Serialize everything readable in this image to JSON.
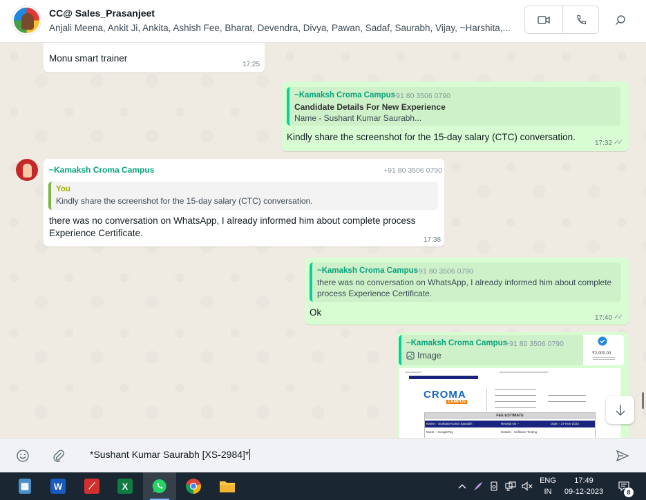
{
  "header": {
    "title": "CC@ Sales_Prasanjeet",
    "members": "Anjali Meena, Ankit Ji, Ankita, Ashish Fee, Bharat, Devendra, Divya, Pawan, Sadaf, Saurabh, Vijay, ~Harshita,..."
  },
  "messages": {
    "m1": {
      "text": "Monu smart trainer",
      "time": "17:25"
    },
    "m2": {
      "quote_author": "~Kamaksh Croma Campus",
      "quote_phone": "+91 80 3506 0790",
      "quote_line1": "Candidate Details For New Experience",
      "quote_line2": "Name - Sushant Kumar Saurabh...",
      "text": "Kindly share the screenshot for the 15-day salary (CTC) conversation.",
      "time": "17:32"
    },
    "m3": {
      "author": "~Kamaksh Croma Campus",
      "phone": "+91 80 3506 0790",
      "quote_author": "You",
      "quote_text": "Kindly share the screenshot for the 15-day salary (CTC) conversation.",
      "text_line1": "there was no conversation on WhatsApp, I already informed  him about complete process",
      "text_line2": "Experience Certificate.",
      "time": "17:38"
    },
    "m4": {
      "quote_author": "~Kamaksh Croma Campus",
      "quote_phone": "+91 80 3506 0790",
      "quote_line1": "there was no conversation on WhatsApp, I already informed  him about complete",
      "quote_line2": "process Experience Certificate.",
      "text": "Ok",
      "time": "17:40"
    },
    "m5": {
      "quote_author": "~Kamaksh Croma Campus",
      "quote_phone": "+91 80 3506 0790",
      "quote_label": "Image",
      "thumb_amount": "₹2,000.00",
      "doc_brand": "CROMA",
      "doc_brand_sub": "CAMPUS",
      "doc_table_title": "FEE ESTIMATE",
      "doc_row1_a": "Name :- Sushant Kumar Saurabh",
      "doc_row1_b": "Receipt No :- ",
      "doc_row1_c": "Date :- 27-Nov-2023",
      "doc_row2_a": "Mode :- GooglePay",
      "doc_row2_b": "Details :- Software Testing"
    }
  },
  "compose": {
    "text": "*Sushant Kumar Saurabh [XS-2984]*"
  },
  "taskbar": {
    "lang_line1": "ENG",
    "lang_line2": "IN",
    "time": "17:49",
    "date": "09-12-2023",
    "notification_count": "8"
  },
  "colors": {
    "accent": "#06cf9c",
    "outgoing_bubble": "#d9fdd3",
    "chat_bg": "#efeae2",
    "taskbar": "#1b2633"
  }
}
